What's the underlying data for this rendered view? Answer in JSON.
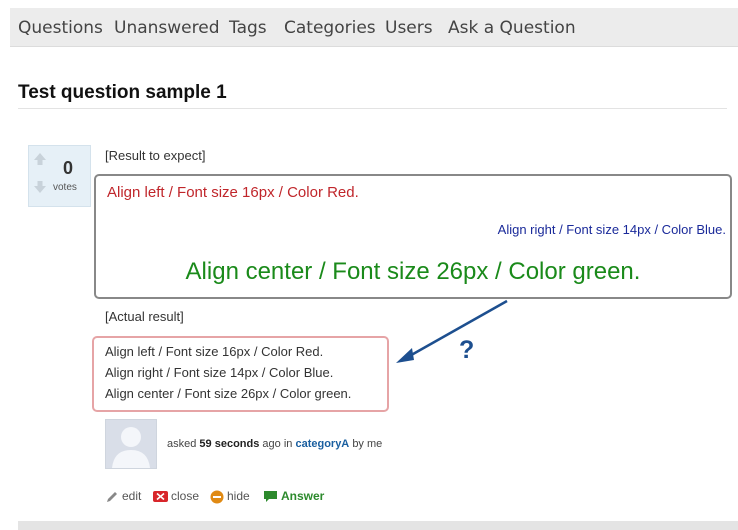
{
  "nav": {
    "items": [
      "Questions",
      "Unanswered",
      "Tags",
      "Categories",
      "Users",
      "Ask a Question"
    ]
  },
  "question": {
    "title": "Test question sample 1",
    "votes": "0",
    "votes_label": "votes",
    "expect_label": "[Result to expect]",
    "expect_lines": {
      "red": "Align left / Font size 16px / Color Red.",
      "blue": "Align right / Font size 14px / Color Blue.",
      "green": "Align center / Font size 26px / Color green."
    },
    "actual_label": "[Actual result]",
    "actual_lines": [
      "Align left / Font size 16px / Color Red.",
      "Align right / Font size 14px / Color Blue.",
      "Align center / Font size 26px / Color green."
    ],
    "annotation": "?"
  },
  "meta": {
    "asked_prefix": "asked",
    "time": "59 seconds",
    "ago": "ago in",
    "category": "categoryA",
    "by": "by me"
  },
  "actions": {
    "edit": "edit",
    "close": "close",
    "hide": "hide",
    "answer": "Answer"
  },
  "colors": {
    "red": "#c0262b",
    "blue": "#1a2a9a",
    "green": "#1a8a1a",
    "expect_border": "#888888",
    "actual_border": "#e6a4a6",
    "arrow": "#1d4f8f"
  }
}
